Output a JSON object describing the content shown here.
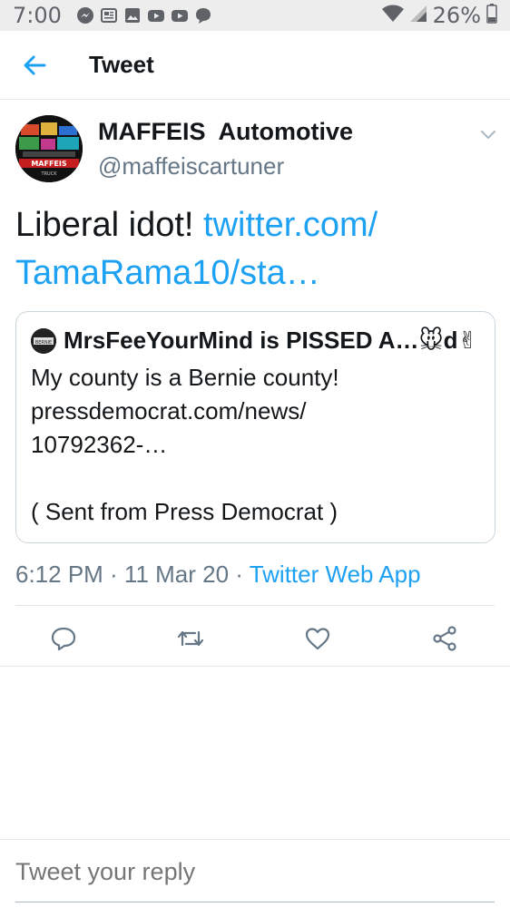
{
  "status_bar": {
    "time": "7:00",
    "battery": "26%",
    "notification_icons": [
      "messenger-icon",
      "news-icon",
      "gallery-icon",
      "youtube-icon",
      "youtube-icon",
      "chat-icon"
    ]
  },
  "app_bar": {
    "title": "Tweet"
  },
  "tweet": {
    "author_name": "MAFFEIS  Automotive",
    "author_handle": "@maffeiscartuner",
    "text": "Liberal idot! ",
    "link": "twitter.com/ TamaRama10/sta…",
    "timestamp": "6:12 PM · 11 Mar 20 · ",
    "source": "Twitter Web App"
  },
  "quote": {
    "author_name": "MrsFeeYourMind is PISSED A…🐭d✌",
    "lines": [
      "My county is a Bernie county!",
      "pressdemocrat.com/news/",
      "10792362-…",
      "",
      "( Sent from Press Democrat )"
    ]
  },
  "reply": {
    "placeholder": "Tweet your reply"
  },
  "colors": {
    "accent": "#1da1f2",
    "secondary_text": "#657786",
    "divider": "#e1e8ed"
  }
}
